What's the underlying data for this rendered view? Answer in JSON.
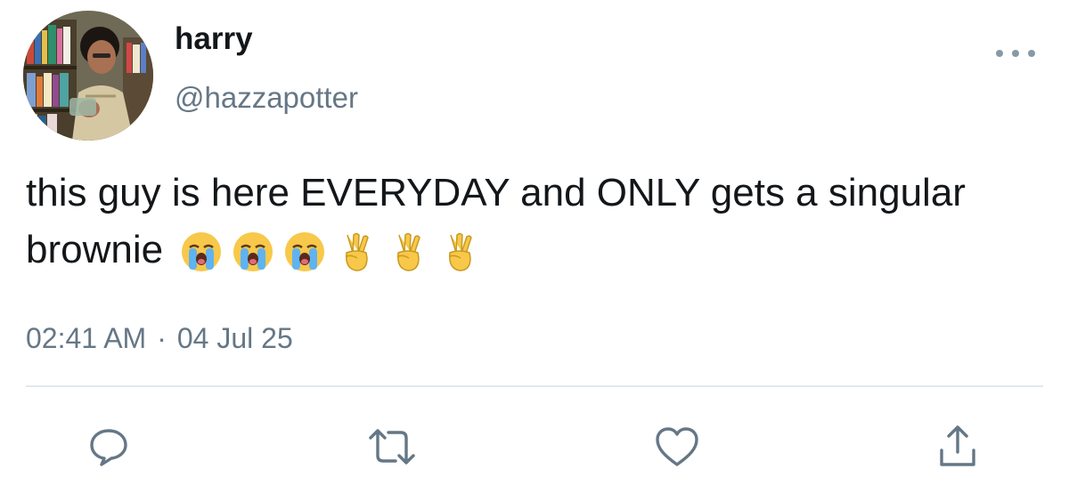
{
  "user": {
    "display_name": "harry",
    "handle": "@hazzapotter"
  },
  "tweet": {
    "text": "this guy is here EVERYDAY and ONLY gets a singular brownie",
    "emojis": [
      "loudly-crying-face",
      "loudly-crying-face",
      "loudly-crying-face",
      "victory-hand",
      "victory-hand",
      "victory-hand"
    ],
    "time": "02:41 AM",
    "separator": "·",
    "date": "04 Jul 25"
  },
  "actions": {
    "reply_icon": "speech-bubble",
    "retweet_icon": "retweet-arrows",
    "like_icon": "heart",
    "share_icon": "upload-arrow"
  },
  "colors": {
    "text_primary": "#14171a",
    "text_secondary": "#657786",
    "icon": "#657786",
    "divider": "#e1e8ed"
  }
}
